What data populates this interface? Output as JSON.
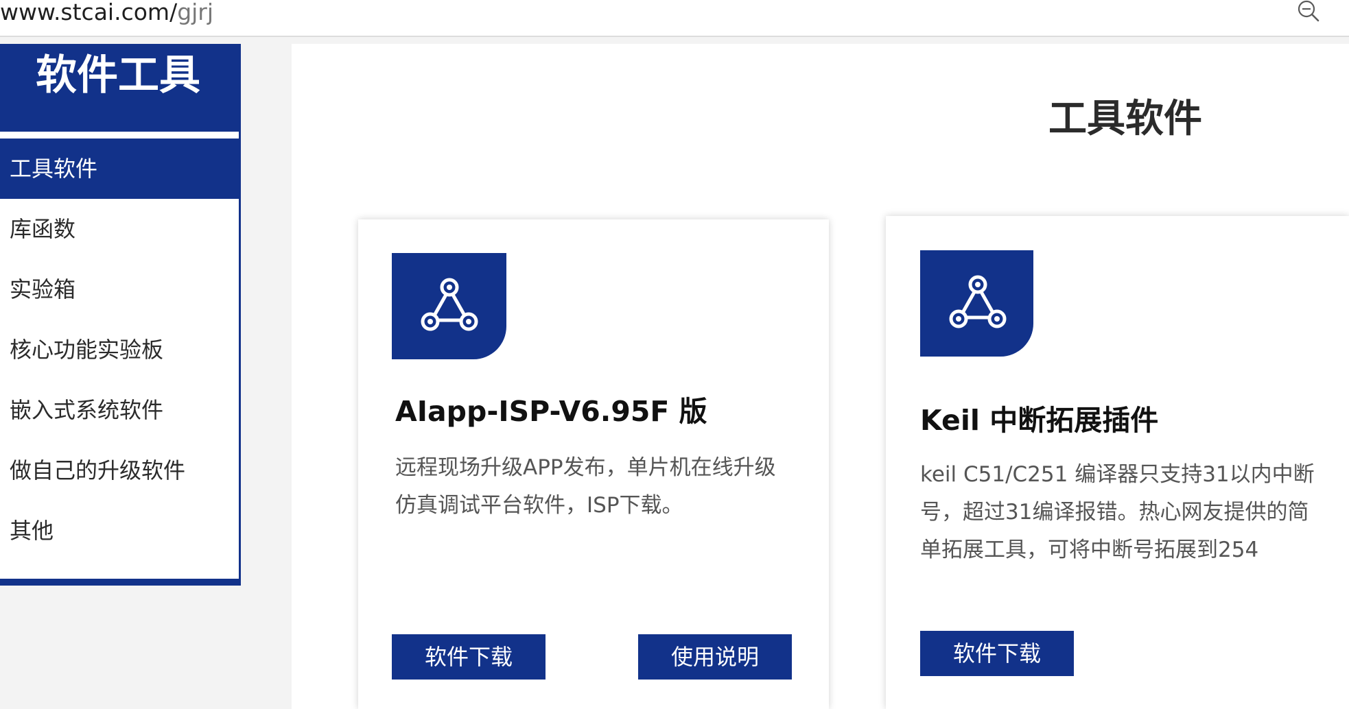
{
  "address_bar": {
    "host": "www.stcai.com/",
    "path": "gjrj",
    "zoom_icon": "zoom-out-icon"
  },
  "sidebar": {
    "title": "软件工具",
    "items": [
      {
        "label": "工具软件",
        "active": true
      },
      {
        "label": "库函数"
      },
      {
        "label": "实验箱"
      },
      {
        "label": "核心功能实验板"
      },
      {
        "label": "嵌入式系统软件"
      },
      {
        "label": "做自己的升级软件"
      },
      {
        "label": "其他"
      }
    ]
  },
  "main": {
    "title": "工具软件",
    "cards": [
      {
        "icon": "share-nodes-icon",
        "title": "AIapp-ISP-V6.95F 版",
        "desc_lines": [
          "远程现场升级APP发布，单片机在线升级",
          "仿真调试平台软件，ISP下载。"
        ],
        "download_label": "软件下载",
        "manual_label": "使用说明"
      },
      {
        "icon": "share-nodes-icon",
        "title": "Keil 中断拓展插件",
        "desc_lines": [
          "keil C51/C251 编译器只支持31以内中断",
          "号，超过31编译报错。热心网友提供的简",
          "单拓展工具，可将中断号拓展到254"
        ],
        "download_label": "软件下载"
      }
    ]
  },
  "colors": {
    "brand_blue": "#12328a",
    "text_dark": "#2b2b2b",
    "text_gray": "#555555"
  }
}
